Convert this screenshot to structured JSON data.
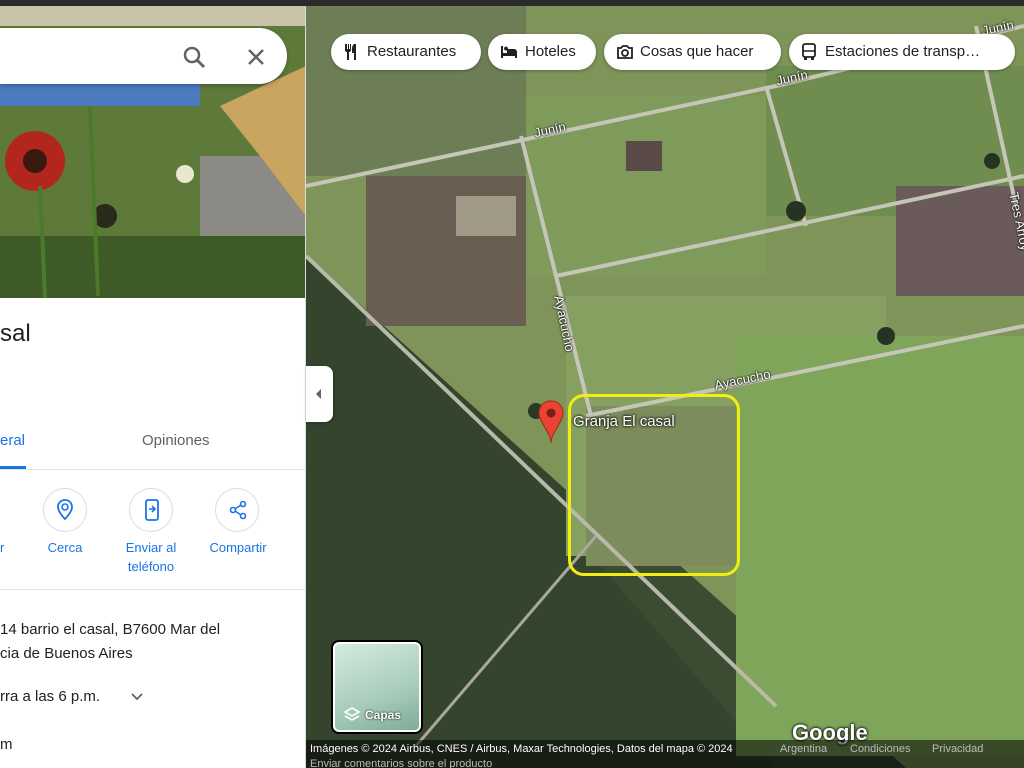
{
  "panel": {
    "title": "Granja El casal",
    "title_visible": "sal",
    "tabs": [
      {
        "label": "General",
        "visible": "eral"
      },
      {
        "label": "Opiniones"
      }
    ],
    "actions": [
      {
        "label": "r",
        "icon": "directions-icon"
      },
      {
        "label": "Cerca",
        "icon": "nearby-icon"
      },
      {
        "label": "Enviar al teléfono",
        "line1": "Enviar al",
        "line2": "teléfono",
        "icon": "send-to-phone-icon"
      },
      {
        "label": "Compartir",
        "icon": "share-icon"
      }
    ],
    "address_line1": "14 barrio el casal, B7600 Mar del",
    "address_line2": "cia de Buenos Aires",
    "hours": "rra a las 6 p.m.",
    "website": "m"
  },
  "chips": [
    {
      "label": "Restaurantes",
      "icon": "fork-knife-icon"
    },
    {
      "label": "Hoteles",
      "icon": "bed-icon"
    },
    {
      "label": "Cosas que hacer",
      "icon": "camera-icon"
    },
    {
      "label": "Estaciones de transp…",
      "icon": "bus-icon"
    }
  ],
  "map": {
    "place_label": "Granja El casal",
    "roads": {
      "junin_1": "Junín",
      "junin_2": "Junín",
      "junin_3": "Junín",
      "ayacucho_1": "Ayacucho",
      "ayacucho_2": "Ayacucho",
      "tres_arroyos": "Tres Arroy"
    },
    "layers_label": "Capas",
    "logo": "Google",
    "attribution": "Imágenes © 2024 Airbus, CNES / Airbus, Maxar Technologies, Datos del mapa © 2024",
    "links": [
      "Argentina",
      "Condiciones",
      "Privacidad"
    ],
    "feedback": "Enviar comentarios sobre el producto",
    "highlight_color": "#f2ee10"
  },
  "colors": {
    "accent": "#1a73e8",
    "pin": "#ea4335"
  }
}
